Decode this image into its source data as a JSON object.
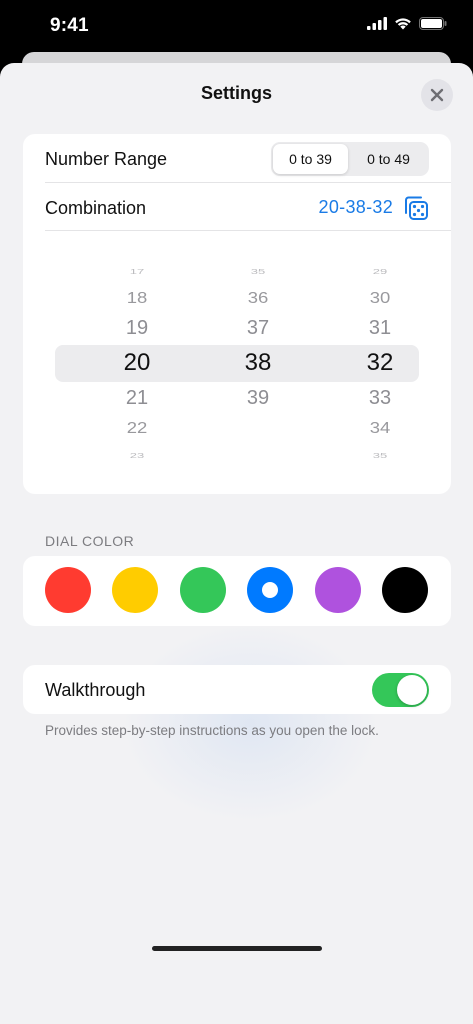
{
  "status_bar": {
    "time": "9:41",
    "icons": [
      "signal-icon",
      "wifi-icon",
      "battery-icon"
    ]
  },
  "sheet": {
    "title": "Settings",
    "close_icon": "close-icon"
  },
  "number_range": {
    "label": "Number Range",
    "options": [
      "0 to 39",
      "0 to 49"
    ],
    "selected_index": 0
  },
  "combination": {
    "label": "Combination",
    "value": "20-38-32",
    "shuffle_icon": "dice-icon"
  },
  "picker": {
    "columns": [
      {
        "items": [
          "17",
          "18",
          "19",
          "20",
          "21",
          "22",
          "23"
        ],
        "selected": "20"
      },
      {
        "items": [
          "35",
          "36",
          "37",
          "38",
          "39"
        ],
        "selected": "38"
      },
      {
        "items": [
          "29",
          "30",
          "31",
          "32",
          "33",
          "34",
          "35"
        ],
        "selected": "32"
      }
    ]
  },
  "dial_color": {
    "header": "DIAL COLOR",
    "colors": [
      "#ff3b30",
      "#ffcc00",
      "#34c759",
      "#007aff",
      "#af52de",
      "#000000"
    ],
    "selected_index": 3
  },
  "walkthrough": {
    "label": "Walkthrough",
    "enabled": true,
    "footnote": "Provides step-by-step instructions as you open the lock."
  }
}
